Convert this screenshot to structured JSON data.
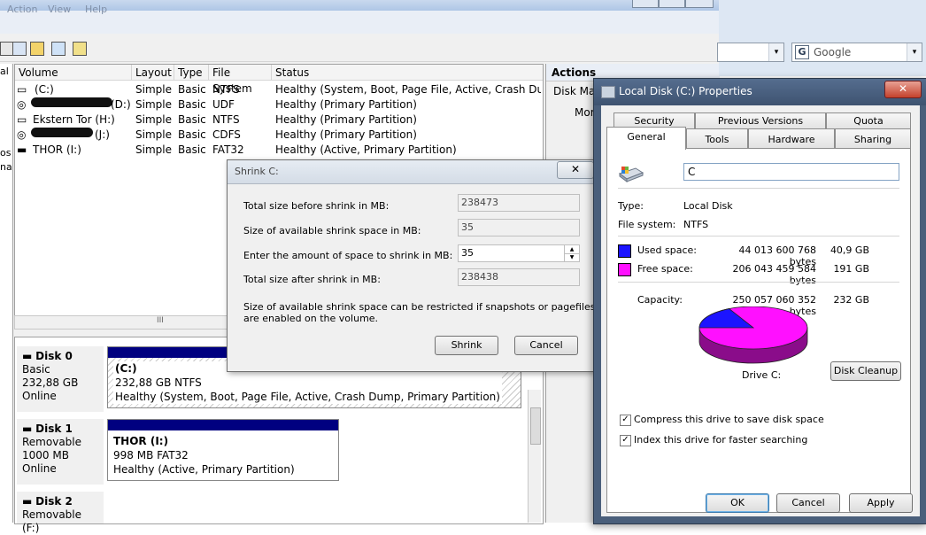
{
  "disk_mgmt": {
    "menu": [
      "Action",
      "View",
      "Help"
    ],
    "columns": [
      "Volume",
      "Layout",
      "Type",
      "File System",
      "Status"
    ],
    "volumes": [
      {
        "name": "(C:)",
        "layout": "Simple",
        "type": "Basic",
        "fs": "NTFS",
        "status": "Healthy (System, Boot, Page File, Active, Crash Dump, Pr"
      },
      {
        "name": "(D:)",
        "redacted": true,
        "layout": "Simple",
        "type": "Basic",
        "fs": "UDF",
        "status": "Healthy (Primary Partition)"
      },
      {
        "name": "Ekstern Tor (H:)",
        "layout": "Simple",
        "type": "Basic",
        "fs": "NTFS",
        "status": "Healthy (Primary Partition)"
      },
      {
        "name": "(J:)",
        "redacted": true,
        "layout": "Simple",
        "type": "Basic",
        "fs": "CDFS",
        "status": "Healthy (Primary Partition)"
      },
      {
        "name": "THOR (I:)",
        "layout": "Simple",
        "type": "Basic",
        "fs": "FAT32",
        "status": "Healthy (Active, Primary Partition)"
      }
    ],
    "left_sliver": [
      "al",
      "os",
      "na"
    ],
    "scroll_mark": "III",
    "actions_header": "Actions",
    "actions_item": "Disk Mar",
    "actions_more": "Mor",
    "disks": [
      {
        "name": "Disk 0",
        "kind": "Basic",
        "size": "232,88 GB",
        "state": "Online",
        "part_title": "(C:)",
        "part_size": "232,88 GB NTFS",
        "part_status": "Healthy (System, Boot, Page File, Active, Crash Dump, Primary Partition)"
      },
      {
        "name": "Disk 1",
        "kind": "Removable",
        "size": "1000 MB",
        "state": "Online",
        "part_title": "THOR  (I:)",
        "part_size": "998 MB FAT32",
        "part_status": "Healthy (Active, Primary Partition)"
      },
      {
        "name": "Disk 2",
        "kind": "Removable (F:)"
      }
    ]
  },
  "browser": {
    "search_placeholder": "Google",
    "search_icon": "G",
    "arrow_glyph": "▾"
  },
  "shrink": {
    "title": "Shrink C:",
    "close_glyph": "✕",
    "rows": [
      {
        "label": "Total size before shrink in MB:",
        "value": "238473"
      },
      {
        "label": "Size of available shrink space in MB:",
        "value": "35"
      },
      {
        "label": "Enter the amount of space to shrink in MB:",
        "value": "35"
      },
      {
        "label": "Total size after shrink in MB:",
        "value": "238438"
      }
    ],
    "note_line1": "Size of available shrink space can be restricted if snapshots or pagefiles",
    "note_line2": "are enabled on the volume.",
    "shrink_button": "Shrink",
    "cancel_button": "Cancel"
  },
  "props": {
    "title": "Local Disk (C:) Properties",
    "close_glyph": "✕",
    "tabs_back": [
      "Security",
      "Previous Versions",
      "Quota"
    ],
    "tabs_front": [
      "General",
      "Tools",
      "Hardware",
      "Sharing"
    ],
    "active_tab": "General",
    "name_value": "C",
    "type_label": "Type:",
    "type_value": "Local Disk",
    "fs_label": "File system:",
    "fs_value": "NTFS",
    "used_label": "Used space:",
    "used_bytes": "44 013 600 768 bytes",
    "used_gb": "40,9 GB",
    "free_label": "Free space:",
    "free_bytes": "206 043 459 584 bytes",
    "free_gb": "191 GB",
    "capacity_label": "Capacity:",
    "capacity_bytes": "250 057 060 352 bytes",
    "capacity_gb": "232 GB",
    "drive_label": "Drive C:",
    "cleanup_button": "Disk Cleanup",
    "compress_label": "Compress this drive to save disk space",
    "index_label": "Index this drive for faster searching",
    "compress_checked": true,
    "index_checked": true,
    "ok_button": "OK",
    "cancel_button": "Cancel",
    "apply_button": "Apply",
    "used_color": "#1c14ff",
    "free_color": "#ff10ff",
    "used_fraction": 0.176
  }
}
